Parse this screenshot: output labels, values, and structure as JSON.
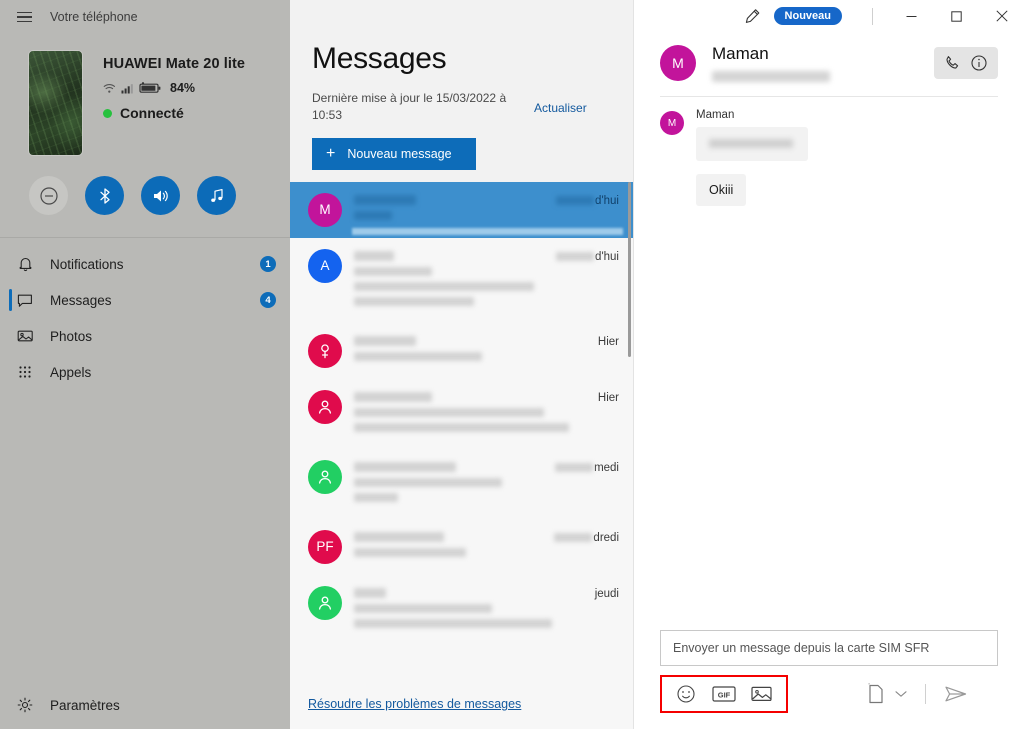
{
  "sidebar": {
    "app_title": "Votre téléphone",
    "menu_icon": "hamburger-icon",
    "device": {
      "name": "HUAWEI Mate 20 lite",
      "battery": "84%",
      "connection_status": "Connecté",
      "status_dot_color": "#27c13e",
      "icons": [
        "wifi-icon",
        "signal-bars-icon",
        "battery-icon"
      ]
    },
    "quick_actions": [
      {
        "name": "do-not-disturb",
        "icon": "minus-circle-icon",
        "color": "#c6c6c3",
        "active": false
      },
      {
        "name": "bluetooth",
        "icon": "bluetooth-icon",
        "color": "#0c6bb8",
        "active": true
      },
      {
        "name": "volume",
        "icon": "speaker-icon",
        "color": "#0c6bb8",
        "active": true
      },
      {
        "name": "media",
        "icon": "music-note-icon",
        "color": "#0c6bb8",
        "active": true
      }
    ],
    "nav_items": [
      {
        "label": "Notifications",
        "icon": "bell-icon",
        "badge": "1",
        "active": false
      },
      {
        "label": "Messages",
        "icon": "chat-bubble-icon",
        "badge": "4",
        "active": true
      },
      {
        "label": "Photos",
        "icon": "photo-icon",
        "badge": "",
        "active": false
      },
      {
        "label": "Appels",
        "icon": "dialpad-icon",
        "badge": "",
        "active": false
      }
    ],
    "settings": {
      "label": "Paramètres",
      "icon": "gear-icon"
    }
  },
  "messages_panel": {
    "title": "Messages",
    "last_update": "Dernière mise à jour le 15/03/2022 à 10:53",
    "refresh_label": "Actualiser",
    "new_message_label": "Nouveau message",
    "new_message_icon": "plus-icon",
    "troubleshoot_label": "Résoudre les problèmes de messages",
    "conversations": [
      {
        "initial": "M",
        "avatar_color": "#c2149b",
        "avatar_type": "letter",
        "time_prefix": true,
        "time": "d'hui",
        "selected": true,
        "lines": [
          62,
          38
        ]
      },
      {
        "initial": "A",
        "avatar_color": "#1463ef",
        "avatar_type": "letter",
        "time_prefix": true,
        "time": "d'hui",
        "selected": false,
        "lines": [
          40,
          78,
          180,
          120
        ]
      },
      {
        "initial": "",
        "avatar_color": "#e00b4c",
        "avatar_type": "female",
        "time_prefix": false,
        "time": "Hier",
        "selected": false,
        "lines": [
          62,
          128
        ]
      },
      {
        "initial": "",
        "avatar_color": "#e00b4c",
        "avatar_type": "person",
        "time_prefix": false,
        "time": "Hier",
        "selected": false,
        "lines": [
          78,
          190,
          215
        ]
      },
      {
        "initial": "",
        "avatar_color": "#22cf63",
        "avatar_type": "person",
        "time_prefix": true,
        "time": "medi",
        "selected": false,
        "lines": [
          102,
          148,
          44
        ]
      },
      {
        "initial": "PF",
        "avatar_color": "#e00b4c",
        "avatar_type": "letter",
        "time_prefix": true,
        "time": "dredi",
        "selected": false,
        "lines": [
          90,
          112
        ]
      },
      {
        "initial": "",
        "avatar_color": "#22cf63",
        "avatar_type": "person",
        "time_prefix": false,
        "time": "jeudi",
        "selected": false,
        "lines": [
          32,
          138,
          198
        ]
      }
    ]
  },
  "titlebar": {
    "edit_icon": "pencil-icon",
    "new_badge": "Nouveau",
    "minimize_icon": "minimize-icon",
    "maximize_icon": "maximize-icon",
    "close_icon": "close-icon"
  },
  "conversation": {
    "contact_name": "Maman",
    "contact_initial": "M",
    "avatar_color": "#c2149b",
    "call_icon": "phone-icon",
    "info_icon": "info-icon",
    "sender_label": "Maman",
    "messages": [
      {
        "text": "",
        "blurred": true
      },
      {
        "text": "Okiii",
        "blurred": false
      }
    ]
  },
  "composer": {
    "placeholder": "Envoyer un message depuis la carte SIM SFR",
    "value": "",
    "emoji_icon": "emoji-icon",
    "gif_icon": "gif-icon",
    "gif_label": "GIF",
    "image_icon": "image-icon",
    "sim_icon": "sim-card-icon",
    "chevron_icon": "chevron-down-icon",
    "send_icon": "send-icon",
    "highlight_color": "#f50000"
  }
}
